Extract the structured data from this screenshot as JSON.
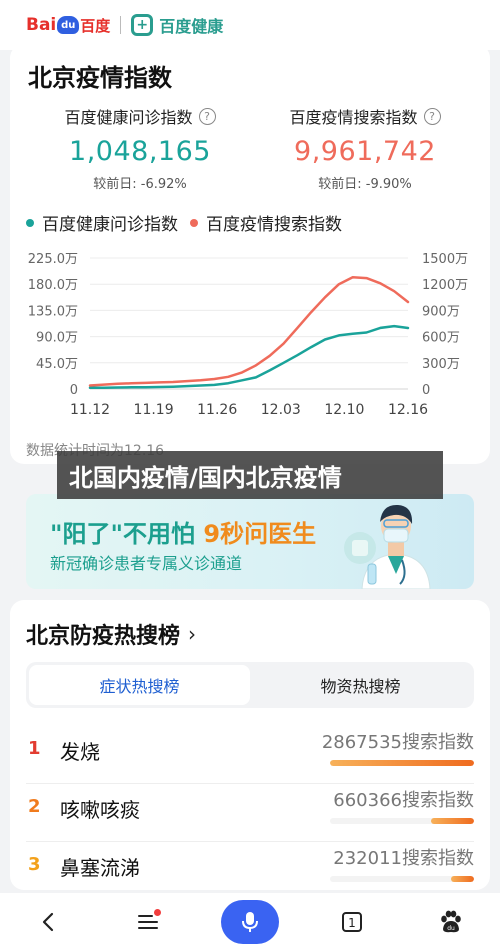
{
  "header": {
    "logo_bai": "Bai",
    "logo_du": "du",
    "logo_cn": "百度",
    "health_logo": "百度健康"
  },
  "card": {
    "title": "北京疫情指数",
    "stats": [
      {
        "label": "百度健康问诊指数",
        "value": "1,048,165",
        "sub_label": "较前日:",
        "sub_value": "-6.92%",
        "color": "#1aa39a"
      },
      {
        "label": "百度疫情搜索指数",
        "value": "9,961,742",
        "sub_label": "较前日:",
        "sub_value": "-9.90%",
        "color": "#ef6b5b"
      }
    ],
    "footnote": "数据统计时间为12.16"
  },
  "chart_data": {
    "type": "line",
    "x": [
      "11.12",
      "11.19",
      "11.26",
      "12.03",
      "12.10",
      "12.16"
    ],
    "left_axis": {
      "ticks": [
        "225.0万",
        "180.0万",
        "135.0万",
        "90.0万",
        "45.0万",
        "0"
      ],
      "range": [
        0,
        225
      ]
    },
    "right_axis": {
      "ticks": [
        "1500万",
        "1200万",
        "900万",
        "600万",
        "300万",
        "0"
      ],
      "range": [
        0,
        1500
      ]
    },
    "series": [
      {
        "name": "百度健康问诊指数",
        "axis": "left",
        "color": "#1aa39a",
        "values": [
          2,
          2,
          2.5,
          3,
          3,
          3.5,
          4,
          5,
          6,
          7,
          10,
          15,
          20,
          32,
          45,
          58,
          72,
          85,
          92,
          95,
          97,
          105,
          108,
          104.8
        ]
      },
      {
        "name": "百度疫情搜索指数",
        "axis": "right",
        "color": "#ef6b5b",
        "values": [
          40,
          50,
          60,
          65,
          70,
          75,
          80,
          90,
          100,
          115,
          140,
          190,
          270,
          380,
          520,
          700,
          880,
          1050,
          1200,
          1280,
          1270,
          1210,
          1120,
          996
        ]
      }
    ]
  },
  "overlay": {
    "text": "北国内疫情/国内北京疫情"
  },
  "ad": {
    "title_part1": "\"阳了\"不用怕 ",
    "title_part2": "9秒问医生",
    "subtitle": "新冠确诊患者专属义诊通道"
  },
  "hot": {
    "title": "北京防疫热搜榜",
    "tabs": [
      "症状热搜榜",
      "物资热搜榜"
    ],
    "rows": [
      {
        "rank": "1",
        "term": "发烧",
        "index": "2867535搜索指数",
        "fraction": 1.0,
        "rank_color": "#e23c31"
      },
      {
        "rank": "2",
        "term": "咳嗽咳痰",
        "index": "660366搜索指数",
        "fraction": 0.3,
        "rank_color": "#f07b1d"
      },
      {
        "rank": "3",
        "term": "鼻塞流涕",
        "index": "232011搜索指数",
        "fraction": 0.16,
        "rank_color": "#f3a11b"
      }
    ]
  },
  "nav": {
    "icons": [
      "back-icon",
      "menu-icon",
      "microphone-icon",
      "tabs-icon",
      "baidu-paw-icon"
    ],
    "tab_count": "1"
  }
}
